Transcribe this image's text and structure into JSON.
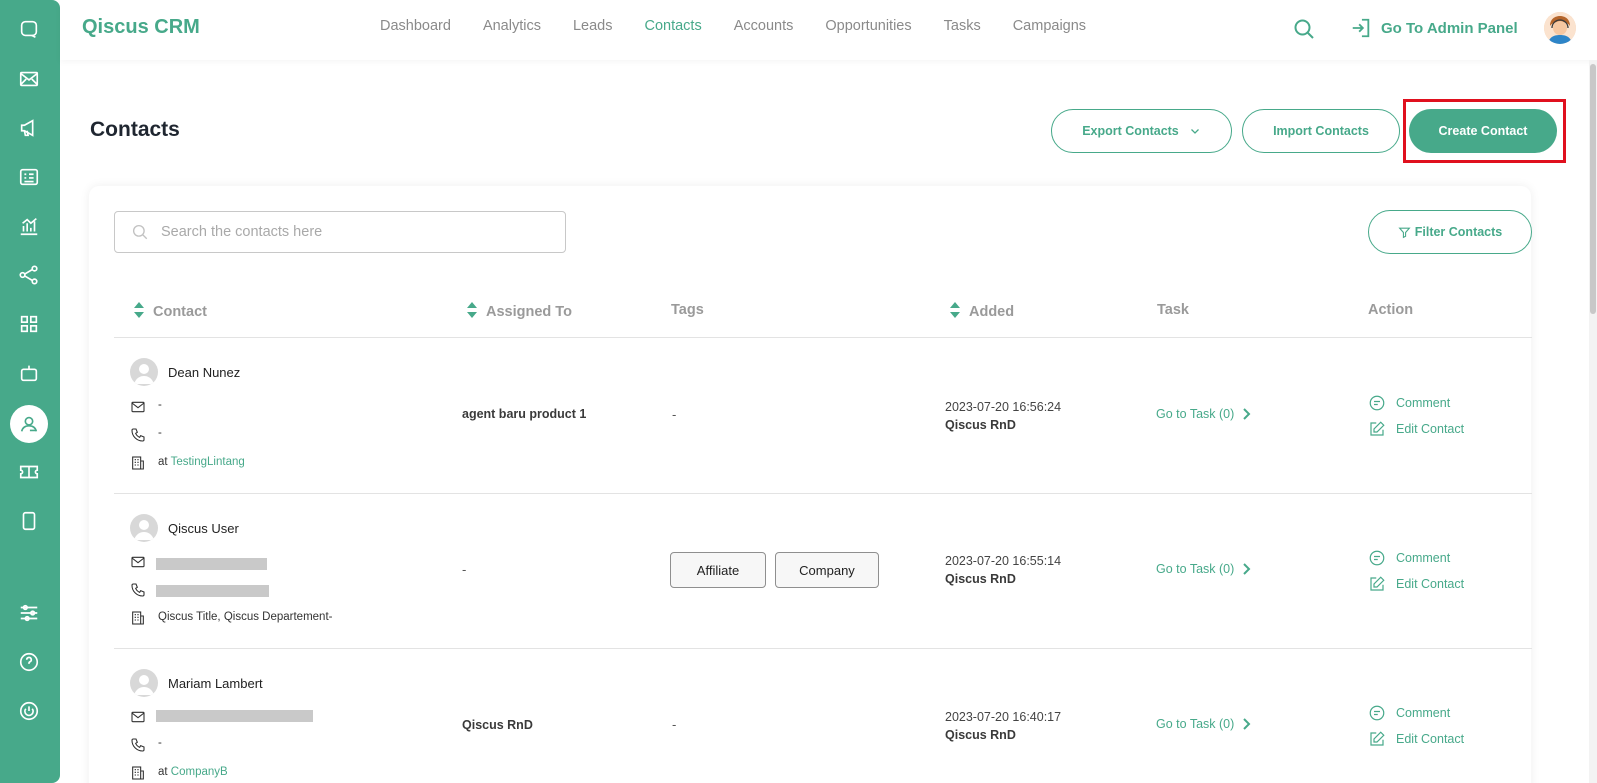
{
  "brand": "Qiscus CRM",
  "nav": [
    "Dashboard",
    "Analytics",
    "Leads",
    "Contacts",
    "Accounts",
    "Opportunities",
    "Tasks",
    "Campaigns"
  ],
  "admin_label": "Go To Admin Panel",
  "page_title": "Contacts",
  "buttons": {
    "export": "Export Contacts",
    "import": "Import Contacts",
    "create": "Create Contact",
    "filter": "Filter Contacts"
  },
  "search": {
    "placeholder": "Search the contacts here"
  },
  "columns": [
    "Contact",
    "Assigned To",
    "Tags",
    "Added",
    "Task",
    "Action"
  ],
  "rows": [
    {
      "name": "Dean Nunez",
      "email": "-",
      "phone": "-",
      "company_prefix": "at",
      "company": "TestingLintang",
      "assigned": "agent baru product 1",
      "tags_text": "-",
      "added_date": "2023-07-20 16:56:24",
      "added_by": "Qiscus RnD",
      "task": "Go to Task (0)",
      "comment": "Comment",
      "edit": "Edit Contact"
    },
    {
      "name": "Qiscus User",
      "email": "",
      "phone": "",
      "company_text": "Qiscus Title, Qiscus Departement-",
      "assigned": "-",
      "tags": [
        "Affiliate",
        "Company"
      ],
      "added_date": "2023-07-20 16:55:14",
      "added_by": "Qiscus RnD",
      "task": "Go to Task (0)",
      "comment": "Comment",
      "edit": "Edit Contact"
    },
    {
      "name": "Mariam Lambert",
      "email": "",
      "phone": "-",
      "company_prefix": "at",
      "company": "CompanyB",
      "assigned": "Qiscus RnD",
      "tags_text": "-",
      "added_date": "2023-07-20 16:40:17",
      "added_by": "Qiscus RnD",
      "task": "Go to Task (0)",
      "comment": "Comment",
      "edit": "Edit Contact"
    }
  ],
  "colors": {
    "accent": "#47a98a",
    "highlight": "#e0101e"
  },
  "sidebar_icons": [
    "chat-icon",
    "mail-icon",
    "megaphone-icon",
    "contact-card-icon",
    "chart-icon",
    "share-icon",
    "apps-icon",
    "bot-icon",
    "customer-icon",
    "ticket-icon",
    "mobile-icon",
    "settings-sliders-icon",
    "help-icon",
    "power-icon"
  ]
}
